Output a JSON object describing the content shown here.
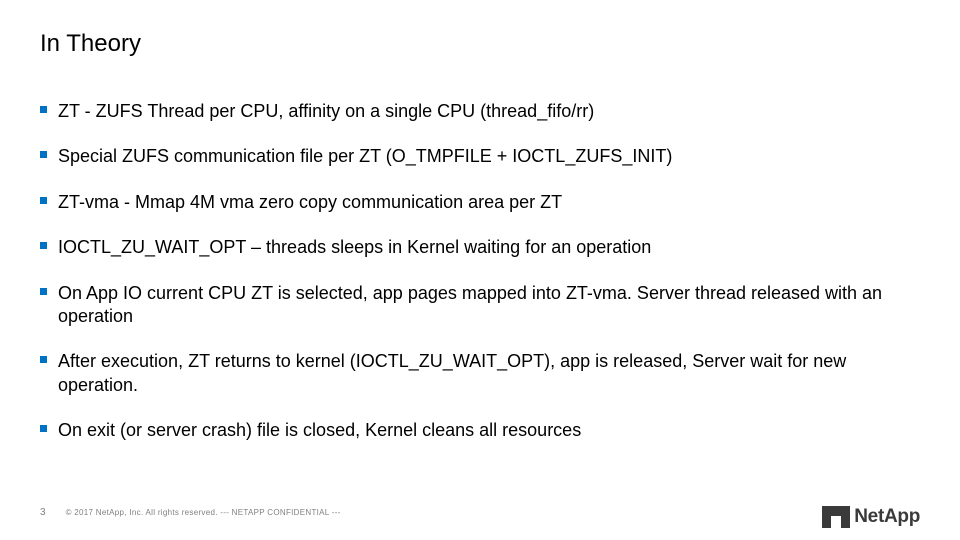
{
  "slide": {
    "title": "In Theory",
    "bullets": [
      "ZT - ZUFS Thread per CPU, affinity on a single CPU (thread_fifo/rr)",
      "Special ZUFS communication file per ZT (O_TMPFILE + IOCTL_ZUFS_INIT)",
      "ZT-vma - Mmap 4M vma zero copy communication area per ZT",
      "IOCTL_ZU_WAIT_OPT – threads sleeps in Kernel waiting for an operation",
      "On App IO current CPU ZT is selected, app pages mapped into ZT-vma. Server thread released with an operation",
      "After execution, ZT returns to kernel (IOCTL_ZU_WAIT_OPT), app is released, Server wait for new operation.",
      "On exit (or server crash) file is closed, Kernel cleans all resources"
    ]
  },
  "footer": {
    "page_number": "3",
    "copyright": "© 2017 NetApp, Inc. All rights reserved.  --- NETAPP CONFIDENTIAL ---"
  },
  "brand": {
    "name": "NetApp"
  },
  "colors": {
    "accent": "#0072c6"
  }
}
